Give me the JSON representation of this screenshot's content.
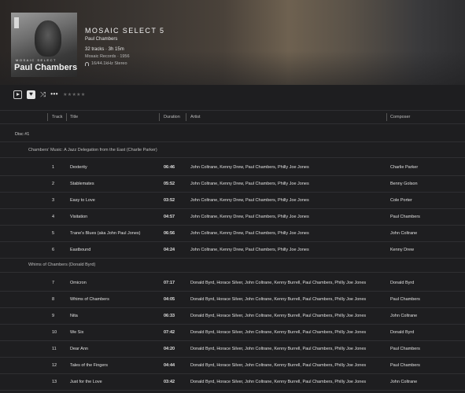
{
  "album": {
    "cover_series": "MOSAIC SELECT",
    "cover_name": "Paul Chambers",
    "title": "MOSAIC SELECT 5",
    "artist": "Paul Chambers",
    "tracks_duration": "32 tracks · 3h 15m",
    "label_year": "Mosaic Records · 1956",
    "quality": "16/44.1kHz Stereo"
  },
  "controls": {
    "fav_glyph": "♥",
    "shuffle_glyph": "⤨",
    "more_glyph": "•••",
    "stars": "★★★★★"
  },
  "columns": {
    "track": "Track",
    "title": "Title",
    "duration": "Duration",
    "artist": "Artist",
    "composer": "Composer"
  },
  "disc_label": "Disc #1",
  "groups": [
    {
      "name": "Chambers' Music: A Jazz Delegation from the East (Charlie Parker)",
      "tracks": [
        {
          "n": "1",
          "title": "Dexterity",
          "dur": "06:46",
          "artist": "John Coltrane, Kenny Drew, Paul Chambers, Philly Joe Jones",
          "composer": "Charlie Parker"
        },
        {
          "n": "2",
          "title": "Stablemates",
          "dur": "05:52",
          "artist": "John Coltrane, Kenny Drew, Paul Chambers, Philly Joe Jones",
          "composer": "Benny Golson"
        },
        {
          "n": "3",
          "title": "Easy to Love",
          "dur": "03:52",
          "artist": "John Coltrane, Kenny Drew, Paul Chambers, Philly Joe Jones",
          "composer": "Cole Porter"
        },
        {
          "n": "4",
          "title": "Visitation",
          "dur": "04:57",
          "artist": "John Coltrane, Kenny Drew, Paul Chambers, Philly Joe Jones",
          "composer": "Paul Chambers"
        },
        {
          "n": "5",
          "title": "Trane's Blues (aka John Paul Jones)",
          "dur": "06:56",
          "artist": "John Coltrane, Kenny Drew, Paul Chambers, Philly Joe Jones",
          "composer": "John Coltrane"
        },
        {
          "n": "6",
          "title": "Eastbound",
          "dur": "04:24",
          "artist": "John Coltrane, Kenny Drew, Paul Chambers, Philly Joe Jones",
          "composer": "Kenny Drew"
        }
      ]
    },
    {
      "name": "Whims of Chambers (Donald Byrd)",
      "tracks": [
        {
          "n": "7",
          "title": "Omicron",
          "dur": "07:17",
          "artist": "Donald Byrd, Horace Silver, John Coltrane, Kenny Burrell, Paul Chambers, Philly Joe Jones",
          "composer": "Donald Byrd"
        },
        {
          "n": "8",
          "title": "Whims of Chambers",
          "dur": "04:05",
          "artist": "Donald Byrd, Horace Silver, John Coltrane, Kenny Burrell, Paul Chambers, Philly Joe Jones",
          "composer": "Paul Chambers"
        },
        {
          "n": "9",
          "title": "Nita",
          "dur": "06:33",
          "artist": "Donald Byrd, Horace Silver, John Coltrane, Kenny Burrell, Paul Chambers, Philly Joe Jones",
          "composer": "John Coltrane"
        },
        {
          "n": "10",
          "title": "We Six",
          "dur": "07:42",
          "artist": "Donald Byrd, Horace Silver, John Coltrane, Kenny Burrell, Paul Chambers, Philly Joe Jones",
          "composer": "Donald Byrd"
        },
        {
          "n": "11",
          "title": "Dear Ann",
          "dur": "04:20",
          "artist": "Donald Byrd, Horace Silver, John Coltrane, Kenny Burrell, Paul Chambers, Philly Joe Jones",
          "composer": "Paul Chambers"
        },
        {
          "n": "12",
          "title": "Tales of the Fingers",
          "dur": "04:44",
          "artist": "Donald Byrd, Horace Silver, John Coltrane, Kenny Burrell, Paul Chambers, Philly Joe Jones",
          "composer": "Paul Chambers"
        },
        {
          "n": "13",
          "title": "Just for the Love",
          "dur": "03:42",
          "artist": "Donald Byrd, Horace Silver, John Coltrane, Kenny Burrell, Paul Chambers, Philly Joe Jones",
          "composer": "John Coltrane"
        }
      ]
    }
  ]
}
